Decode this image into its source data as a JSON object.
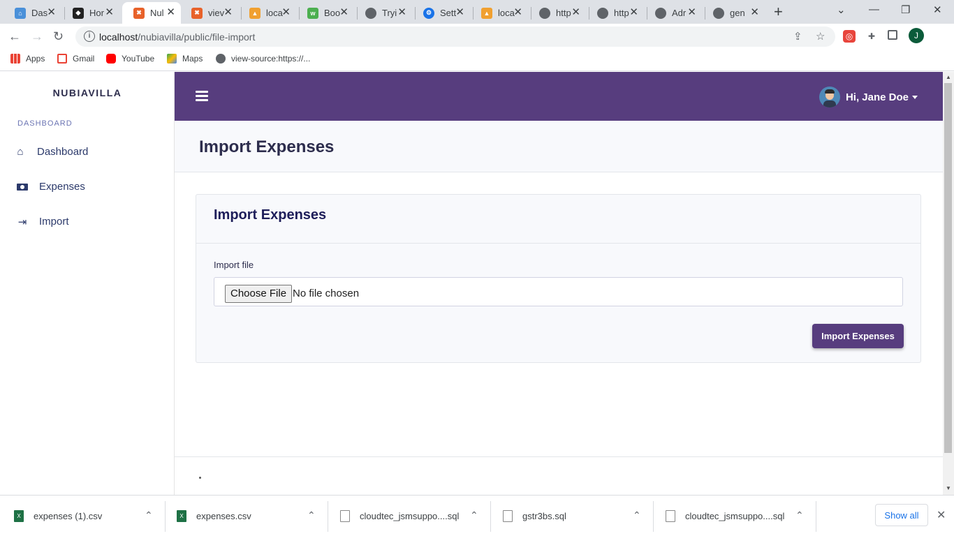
{
  "browser": {
    "tabs": [
      {
        "title": "Das",
        "icon": "home-icon",
        "color": "#4a90d9"
      },
      {
        "title": "Hor",
        "icon": "shield-icon",
        "color": "#222222"
      },
      {
        "title": "Nul",
        "icon": "xampp-icon",
        "color": "#e8622a",
        "active": true
      },
      {
        "title": "viev",
        "icon": "xampp-icon",
        "color": "#e8622a"
      },
      {
        "title": "loca",
        "icon": "phpmyadmin-icon",
        "color": "#f0a030"
      },
      {
        "title": "Boo",
        "icon": "w3schools-icon",
        "color": "#4caf50"
      },
      {
        "title": "Tryi",
        "icon": "globe-icon",
        "color": "#5f6368"
      },
      {
        "title": "Sett",
        "icon": "gear-icon",
        "color": "#1a73e8"
      },
      {
        "title": "loca",
        "icon": "phpmyadmin-icon",
        "color": "#f0a030"
      },
      {
        "title": "http",
        "icon": "globe-icon",
        "color": "#5f6368"
      },
      {
        "title": "http",
        "icon": "globe-icon",
        "color": "#5f6368"
      },
      {
        "title": "Adr",
        "icon": "globe-icon",
        "color": "#5f6368"
      },
      {
        "title": "gen",
        "icon": "globe-icon",
        "color": "#5f6368"
      }
    ],
    "url_host": "localhost",
    "url_path": "/nubiavilla/public/file-import",
    "profile_initial": "J",
    "bookmarks": [
      {
        "label": "Apps",
        "icon": "apps-grid-icon"
      },
      {
        "label": "Gmail",
        "icon": "gmail-icon"
      },
      {
        "label": "YouTube",
        "icon": "youtube-icon"
      },
      {
        "label": "Maps",
        "icon": "maps-icon"
      },
      {
        "label": "view-source:https://...",
        "icon": "globe-icon"
      }
    ]
  },
  "app": {
    "brand": "NUBIAVILLA",
    "sidebar_heading": "DASHBOARD",
    "nav": [
      {
        "label": "Dashboard",
        "icon": "home-icon"
      },
      {
        "label": "Expenses",
        "icon": "money-icon"
      },
      {
        "label": "Import",
        "icon": "file-import-icon"
      }
    ],
    "user_greeting": "Hi, Jane Doe",
    "page_title": "Import Expenses",
    "card_title": "Import Expenses",
    "field_label": "Import file",
    "choose_file_label": "Choose File",
    "no_file_text": "No file chosen",
    "submit_label": "Import Expenses",
    "accent_color": "#573d7e"
  },
  "downloads": {
    "items": [
      {
        "name": "expenses (1).csv",
        "type": "xls"
      },
      {
        "name": "expenses.csv",
        "type": "xls"
      },
      {
        "name": "cloudtec_jsmsuppo....sql",
        "type": "doc"
      },
      {
        "name": "gstr3bs.sql",
        "type": "doc"
      },
      {
        "name": "cloudtec_jsmsuppo....sql",
        "type": "doc"
      }
    ],
    "show_all_label": "Show all"
  }
}
